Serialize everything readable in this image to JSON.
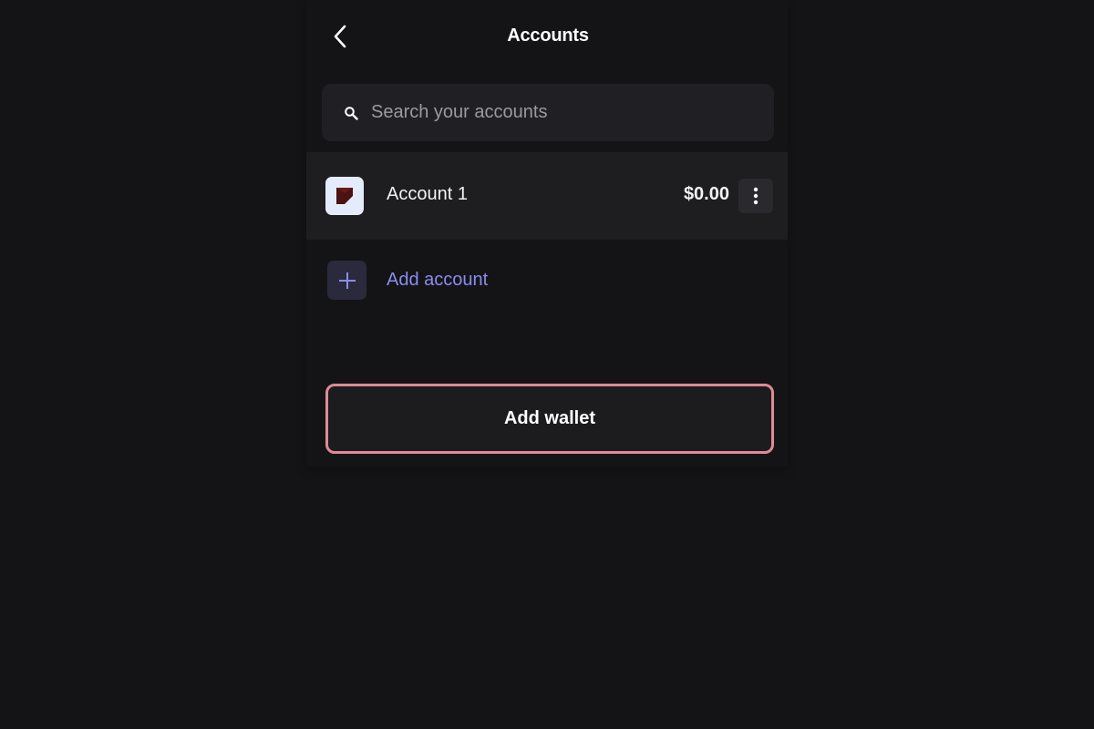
{
  "header": {
    "back_icon": "chevron-left-icon",
    "title": "Accounts"
  },
  "search": {
    "icon": "search-icon",
    "placeholder": "Search your accounts",
    "value": ""
  },
  "accounts": [
    {
      "name": "Account 1",
      "balance": "$0.00",
      "avatar_icon": "account-logo-icon",
      "avatar_bg": "#e4ecfb",
      "menu_icon": "more-vertical-icon"
    }
  ],
  "add_account": {
    "icon": "plus-icon",
    "label": "Add account",
    "color": "#8a8cf0"
  },
  "add_wallet": {
    "label": "Add wallet",
    "border_color": "#de8a96"
  },
  "colors": {
    "background": "#141416",
    "row_background": "#1e1e21"
  }
}
